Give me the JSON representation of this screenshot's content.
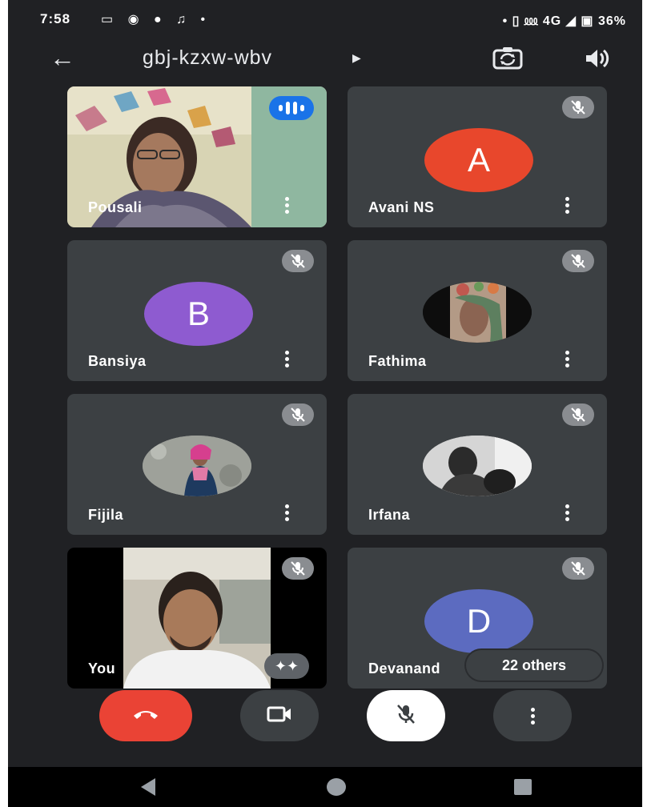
{
  "status_bar": {
    "time": "7:58",
    "left_icons": "▭ ◉ ● ♫ •",
    "right_icons": "• ▯ ⅏ 4G ◢ ▣ 36%"
  },
  "header": {
    "meeting_code": "gbj-kzxw-wbv",
    "icons": [
      "back-arrow-icon",
      "caret-right-icon",
      "switch-camera-icon",
      "speaker-icon"
    ]
  },
  "participants": [
    {
      "name": "Pousali",
      "type": "video",
      "speaking": true
    },
    {
      "name": "Avani NS",
      "type": "letter",
      "letter": "A",
      "color": "#e8472c",
      "muted": true
    },
    {
      "name": "Bansiya",
      "type": "letter",
      "letter": "B",
      "color": "#8e5bd0",
      "muted": true
    },
    {
      "name": "Fathima",
      "type": "photo",
      "muted": true
    },
    {
      "name": "Fijila",
      "type": "photo",
      "muted": true
    },
    {
      "name": "Irfana",
      "type": "photo",
      "muted": true
    },
    {
      "name": "You",
      "type": "video",
      "muted": true
    },
    {
      "name": "Devanand",
      "type": "letter",
      "letter": "D",
      "color": "#5c6bc0",
      "muted": true
    }
  ],
  "others_label": "22 others",
  "controls": [
    "end-call-icon",
    "camera-icon",
    "mic-off-icon",
    "more-vert-icon"
  ],
  "colors": {
    "background": "#202124",
    "tile": "#3c4043",
    "end_call": "#ea4335",
    "speaking": "#1a73e8"
  }
}
